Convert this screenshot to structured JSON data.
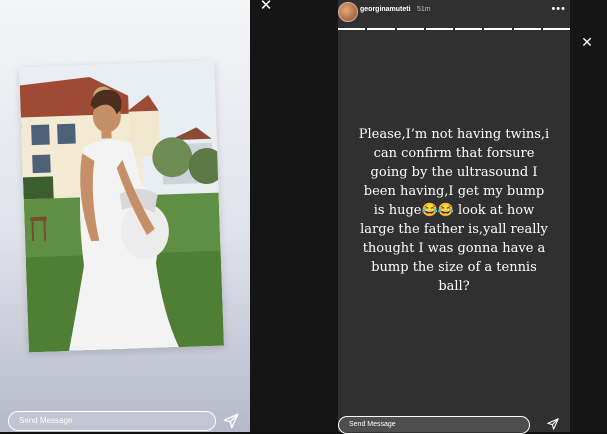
{
  "left_story": {
    "send_placeholder": "Send Message"
  },
  "right_story": {
    "username": "georginamuteti",
    "time": "51m",
    "more_icon": "•••",
    "close_icon": "✕",
    "text": "Please,I’m not having twins,i can confirm that forsure going by the ultrasound I been having,I get my bump is huge😂😂 look at how large the father is,yall really thought I was gonna have a bump the size of a tennis ball?",
    "send_placeholder": "Send Message",
    "progress_segments": 8,
    "progress_active": 8
  },
  "icons": {
    "send": "send-icon",
    "close": "close-icon",
    "more": "more-icon"
  }
}
